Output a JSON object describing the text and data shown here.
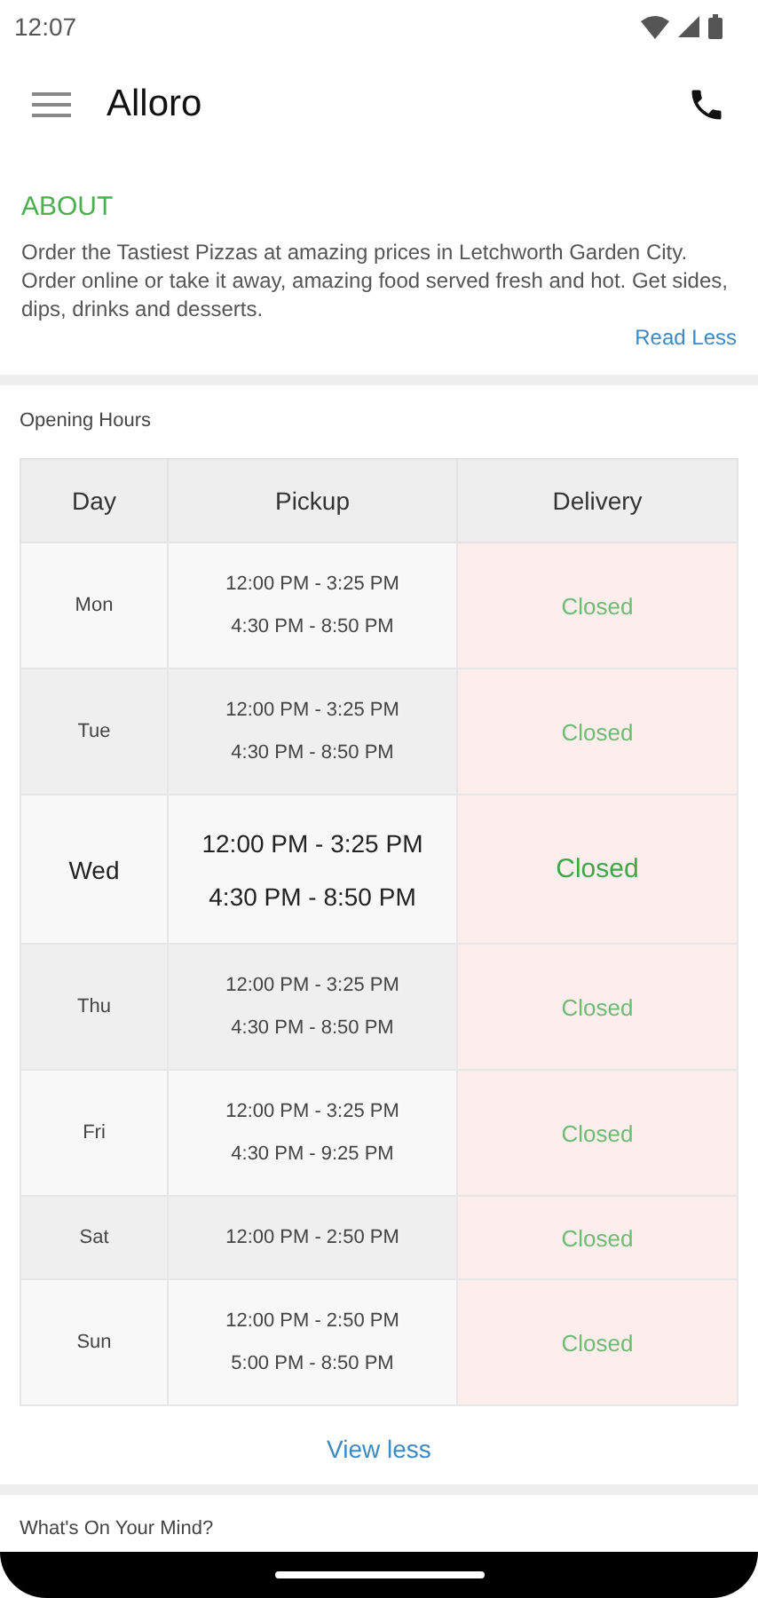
{
  "status_bar": {
    "time": "12:07"
  },
  "app_bar": {
    "title": "Alloro"
  },
  "about": {
    "heading": "ABOUT",
    "text": "Order the Tastiest Pizzas at amazing prices in Letchworth Garden City. Order online or take it away, amazing food served fresh and hot. Get sides, dips, drinks and desserts.",
    "toggle": "Read Less"
  },
  "opening_hours": {
    "title": "Opening Hours",
    "columns": [
      "Day",
      "Pickup",
      "Delivery"
    ],
    "rows": [
      {
        "day": "Mon",
        "pickup": [
          "12:00 PM - 3:25 PM",
          "4:30 PM - 8:50 PM"
        ],
        "delivery": "Closed",
        "selected": false
      },
      {
        "day": "Tue",
        "pickup": [
          "12:00 PM - 3:25 PM",
          "4:30 PM - 8:50 PM"
        ],
        "delivery": "Closed",
        "selected": false
      },
      {
        "day": "Wed",
        "pickup": [
          "12:00 PM - 3:25 PM",
          "4:30 PM - 8:50 PM"
        ],
        "delivery": "Closed",
        "selected": true
      },
      {
        "day": "Thu",
        "pickup": [
          "12:00 PM - 3:25 PM",
          "4:30 PM - 8:50 PM"
        ],
        "delivery": "Closed",
        "selected": false
      },
      {
        "day": "Fri",
        "pickup": [
          "12:00 PM - 3:25 PM",
          "4:30 PM - 9:25 PM"
        ],
        "delivery": "Closed",
        "selected": false
      },
      {
        "day": "Sat",
        "pickup": [
          "12:00 PM - 2:50 PM"
        ],
        "delivery": "Closed",
        "selected": false
      },
      {
        "day": "Sun",
        "pickup": [
          "12:00 PM - 2:50 PM",
          "5:00 PM - 8:50 PM"
        ],
        "delivery": "Closed",
        "selected": false
      }
    ],
    "toggle": "View less"
  },
  "next_section": {
    "title": "What's On Your Mind?"
  }
}
